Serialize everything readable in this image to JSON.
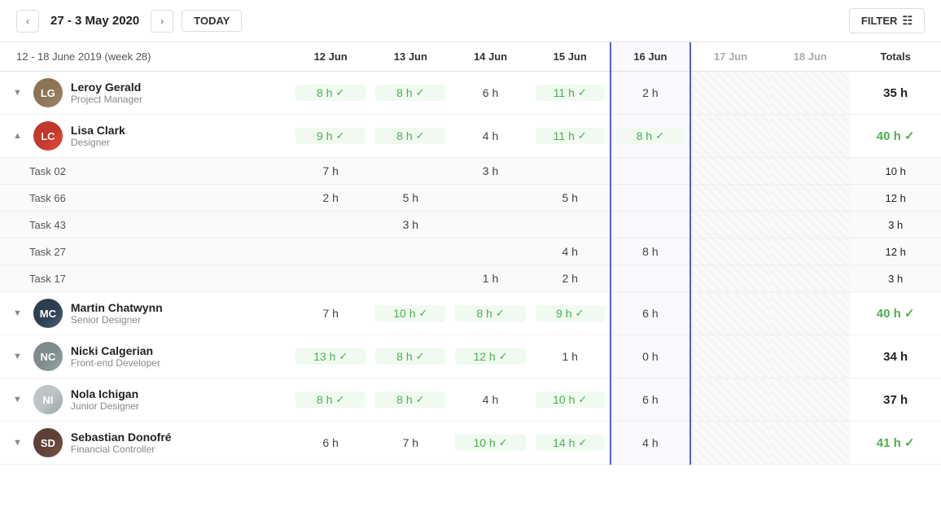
{
  "header": {
    "date_range": "27 - 3 May 2020",
    "today_label": "TODAY",
    "filter_label": "FILTER"
  },
  "week_label": "12 - 18 June 2019 (week 28)",
  "columns": {
    "days": [
      "12 Jun",
      "13 Jun",
      "14 Jun",
      "15 Jun",
      "16 Jun",
      "17 Jun",
      "18 Jun"
    ],
    "totals": "Totals"
  },
  "people": [
    {
      "id": "leroy",
      "name": "Leroy Gerald",
      "role": "Project Manager",
      "avatar_initials": "LG",
      "avatar_class": "avatar-leroy",
      "collapsed": true,
      "hours": [
        "8 h",
        "8 h",
        "6 h",
        "11 h",
        "2 h",
        "",
        ""
      ],
      "hours_check": [
        true,
        true,
        false,
        true,
        false,
        false,
        false
      ],
      "total": "35 h",
      "total_check": false,
      "tasks": []
    },
    {
      "id": "lisa",
      "name": "Lisa Clark",
      "role": "Designer",
      "avatar_initials": "LC",
      "avatar_class": "avatar-lisa",
      "collapsed": false,
      "hours": [
        "9 h",
        "8 h",
        "4 h",
        "11 h",
        "8 h",
        "",
        ""
      ],
      "hours_check": [
        true,
        true,
        false,
        true,
        true,
        false,
        false
      ],
      "total": "40 h",
      "total_check": true,
      "tasks": [
        {
          "name": "Task 02",
          "hours": [
            "7 h",
            "",
            "3 h",
            "",
            "",
            "",
            ""
          ],
          "total": "10 h"
        },
        {
          "name": "Task 66",
          "hours": [
            "2 h",
            "5 h",
            "",
            "5 h",
            "",
            "",
            ""
          ],
          "total": "12 h"
        },
        {
          "name": "Task 43",
          "hours": [
            "",
            "3 h",
            "",
            "",
            "",
            "",
            ""
          ],
          "total": "3 h"
        },
        {
          "name": "Task 27",
          "hours": [
            "",
            "",
            "",
            "4 h",
            "8 h",
            "",
            ""
          ],
          "total": "12 h"
        },
        {
          "name": "Task 17",
          "hours": [
            "",
            "",
            "1 h",
            "2 h",
            "",
            "",
            ""
          ],
          "total": "3 h"
        }
      ]
    },
    {
      "id": "martin",
      "name": "Martin Chatwynn",
      "role": "Senior Designer",
      "avatar_initials": "MC",
      "avatar_class": "avatar-martin",
      "collapsed": true,
      "hours": [
        "7 h",
        "10 h",
        "8 h",
        "9 h",
        "6 h",
        "",
        ""
      ],
      "hours_check": [
        false,
        true,
        true,
        true,
        false,
        false,
        false
      ],
      "total": "40 h",
      "total_check": true,
      "tasks": []
    },
    {
      "id": "nicki",
      "name": "Nicki Calgerian",
      "role": "Front-end Developer",
      "avatar_initials": "NC",
      "avatar_class": "avatar-nicki",
      "collapsed": true,
      "hours": [
        "13 h",
        "8 h",
        "12 h",
        "1 h",
        "0 h",
        "",
        ""
      ],
      "hours_check": [
        true,
        true,
        true,
        false,
        false,
        false,
        false
      ],
      "total": "34 h",
      "total_check": false,
      "tasks": []
    },
    {
      "id": "nola",
      "name": "Nola Ichigan",
      "role": "Junior Designer",
      "avatar_initials": "NI",
      "avatar_class": "avatar-nola",
      "collapsed": true,
      "hours": [
        "8 h",
        "8 h",
        "4 h",
        "10 h",
        "6 h",
        "",
        ""
      ],
      "hours_check": [
        true,
        true,
        false,
        true,
        false,
        false,
        false
      ],
      "total": "37 h",
      "total_check": false,
      "tasks": []
    },
    {
      "id": "sebastian",
      "name": "Sebastian Donofré",
      "role": "Financial Controller",
      "avatar_initials": "SD",
      "avatar_class": "avatar-sebastian",
      "collapsed": true,
      "hours": [
        "6 h",
        "7 h",
        "10 h",
        "14 h",
        "4 h",
        "",
        ""
      ],
      "hours_check": [
        false,
        false,
        true,
        true,
        false,
        false,
        false
      ],
      "total": "41 h",
      "total_check": true,
      "tasks": []
    }
  ]
}
